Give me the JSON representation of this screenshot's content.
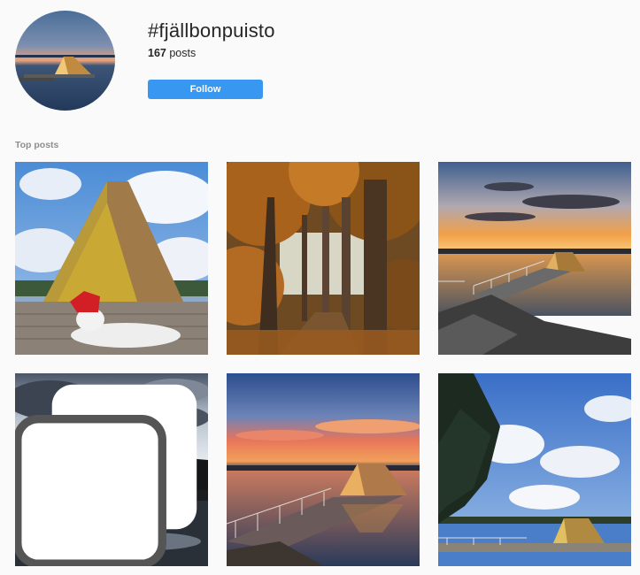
{
  "header": {
    "hashtag": "#fjällbonpuisto",
    "post_count": "167",
    "post_count_suffix": " posts",
    "follow_label": "Follow"
  },
  "section": {
    "title": "Top posts"
  },
  "posts": [
    {
      "subject": "a-frame shelter on pier with person in red hat",
      "multi": false
    },
    {
      "subject": "autumn forest path",
      "multi": false
    },
    {
      "subject": "sunset over lake with pier and shelter",
      "multi": false
    },
    {
      "subject": "dark clouds reflected on lake",
      "multi": true
    },
    {
      "subject": "sunset pier and a-frame shelter",
      "multi": false
    },
    {
      "subject": "blue sky with clouds, pier and shelter",
      "multi": false
    }
  ],
  "colors": {
    "follow_bg": "#3897f0",
    "background": "#fafafa",
    "muted_text": "#8e8e8e"
  }
}
